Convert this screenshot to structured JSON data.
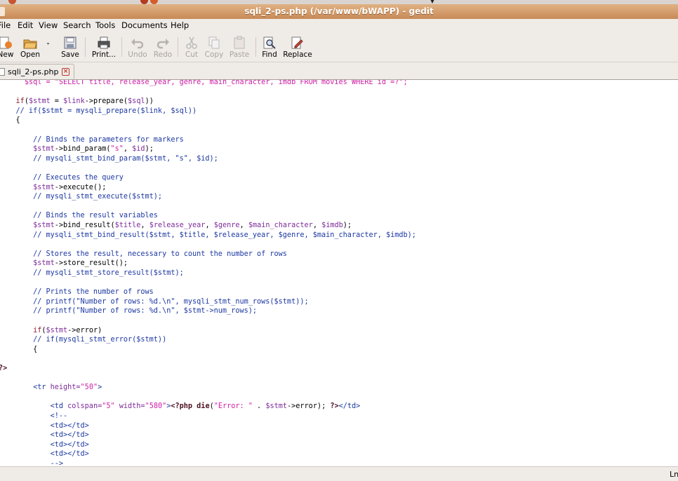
{
  "window": {
    "title": "sqli_2-ps.php (/var/www/bWAPP) - gedit"
  },
  "menu": [
    "File",
    "Edit",
    "View",
    "Search",
    "Tools",
    "Documents",
    "Help"
  ],
  "toolbar": {
    "new": "New",
    "open": "Open",
    "save": "Save",
    "print": "Print...",
    "undo": "Undo",
    "redo": "Redo",
    "cut": "Cut",
    "copy": "Copy",
    "paste": "Paste",
    "find": "Find",
    "replace": "Replace"
  },
  "tab": {
    "label": "sqli_2-ps.php"
  },
  "code_lines": [
    [
      {
        "t": "      "
      },
      {
        "c": "st",
        "t": "$sql = \"SELECT title, release_year, genre, main_character, imdb FROM movies WHERE id =?\";"
      }
    ],
    [
      {
        "t": ""
      }
    ],
    [
      {
        "c": "kw",
        "t": "    if"
      },
      {
        "t": "("
      },
      {
        "c": "vr",
        "t": "$stmt"
      },
      {
        "t": " = "
      },
      {
        "c": "vr",
        "t": "$link"
      },
      {
        "t": "->prepare("
      },
      {
        "c": "vr",
        "t": "$sql"
      },
      {
        "t": "))"
      }
    ],
    [
      {
        "c": "cm",
        "t": "    // if($stmt = mysqli_prepare($link, $sql))"
      }
    ],
    [
      {
        "t": "    {"
      }
    ],
    [
      {
        "t": ""
      }
    ],
    [
      {
        "c": "cm",
        "t": "        // Binds the parameters for markers"
      }
    ],
    [
      {
        "c": "vr",
        "t": "        $stmt"
      },
      {
        "t": "->bind_param("
      },
      {
        "c": "st",
        "t": "\"s\""
      },
      {
        "t": ", "
      },
      {
        "c": "vr",
        "t": "$id"
      },
      {
        "t": ");"
      }
    ],
    [
      {
        "c": "cm",
        "t": "        // mysqli_stmt_bind_param($stmt, \"s\", $id);"
      }
    ],
    [
      {
        "t": ""
      }
    ],
    [
      {
        "c": "cm",
        "t": "        // Executes the query"
      }
    ],
    [
      {
        "c": "vr",
        "t": "        $stmt"
      },
      {
        "t": "->execute();"
      }
    ],
    [
      {
        "c": "cm",
        "t": "        // mysqli_stmt_execute($stmt);"
      }
    ],
    [
      {
        "t": ""
      }
    ],
    [
      {
        "c": "cm",
        "t": "        // Binds the result variables"
      }
    ],
    [
      {
        "c": "vr",
        "t": "        $stmt"
      },
      {
        "t": "->bind_result("
      },
      {
        "c": "vr",
        "t": "$title"
      },
      {
        "t": ", "
      },
      {
        "c": "vr",
        "t": "$release_year"
      },
      {
        "t": ", "
      },
      {
        "c": "vr",
        "t": "$genre"
      },
      {
        "t": ", "
      },
      {
        "c": "vr",
        "t": "$main_character"
      },
      {
        "t": ", "
      },
      {
        "c": "vr",
        "t": "$imdb"
      },
      {
        "t": ");"
      }
    ],
    [
      {
        "c": "cm",
        "t": "        // mysqli_stmt_bind_result($stmt, $title, $release_year, $genre, $main_character, $imdb);"
      }
    ],
    [
      {
        "t": ""
      }
    ],
    [
      {
        "c": "cm",
        "t": "        // Stores the result, necessary to count the number of rows"
      }
    ],
    [
      {
        "c": "vr",
        "t": "        $stmt"
      },
      {
        "t": "->store_result();"
      }
    ],
    [
      {
        "c": "cm",
        "t": "        // mysqli_stmt_store_result($stmt);"
      }
    ],
    [
      {
        "t": ""
      }
    ],
    [
      {
        "c": "cm",
        "t": "        // Prints the number of rows"
      }
    ],
    [
      {
        "c": "cm",
        "t": "        // printf(\"Number of rows: %d.\\n\", mysqli_stmt_num_rows($stmt));"
      }
    ],
    [
      {
        "c": "cm",
        "t": "        // printf(\"Number of rows: %d.\\n\", $stmt->num_rows);"
      }
    ],
    [
      {
        "t": ""
      }
    ],
    [
      {
        "c": "kw",
        "t": "        if"
      },
      {
        "t": "("
      },
      {
        "c": "vr",
        "t": "$stmt"
      },
      {
        "t": "->error)"
      }
    ],
    [
      {
        "c": "cm",
        "t": "        // if(mysqli_stmt_error($stmt))"
      }
    ],
    [
      {
        "t": "        {"
      }
    ],
    [
      {
        "t": ""
      }
    ],
    [
      {
        "c": "dk",
        "t": "?>"
      }
    ],
    [
      {
        "t": ""
      }
    ],
    [
      {
        "c": "cm",
        "t": "        <tr "
      },
      {
        "c": "vr",
        "t": "height="
      },
      {
        "c": "st",
        "t": "\"50\""
      },
      {
        "c": "cm",
        "t": ">"
      }
    ],
    [
      {
        "t": ""
      }
    ],
    [
      {
        "c": "cm",
        "t": "            <td "
      },
      {
        "c": "vr",
        "t": "colspan="
      },
      {
        "c": "st",
        "t": "\"5\""
      },
      {
        "c": "vr",
        "t": " width="
      },
      {
        "c": "st",
        "t": "\"580\""
      },
      {
        "c": "cm",
        "t": ">"
      },
      {
        "c": "dk",
        "t": "<?php die"
      },
      {
        "t": "("
      },
      {
        "c": "st",
        "t": "\"Error: \""
      },
      {
        "t": " . "
      },
      {
        "c": "vr",
        "t": "$stmt"
      },
      {
        "t": "->error); "
      },
      {
        "c": "dk",
        "t": "?>"
      },
      {
        "c": "cm",
        "t": "</td>"
      }
    ],
    [
      {
        "c": "cm",
        "t": "            <!--"
      }
    ],
    [
      {
        "c": "cm",
        "t": "            <td></td>"
      }
    ],
    [
      {
        "c": "cm",
        "t": "            <td></td>"
      }
    ],
    [
      {
        "c": "cm",
        "t": "            <td></td>"
      }
    ],
    [
      {
        "c": "cm",
        "t": "            <td></td>"
      }
    ],
    [
      {
        "c": "cm",
        "t": "            -->"
      }
    ]
  ],
  "status": {
    "text": "Ln"
  }
}
